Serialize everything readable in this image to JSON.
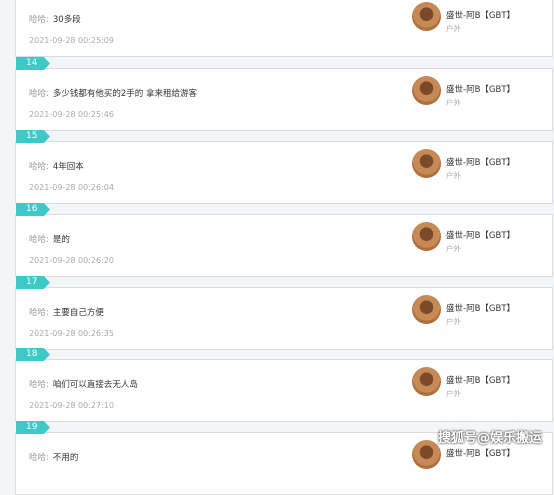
{
  "entries": [
    {
      "tab": "",
      "prefix": "哈哈:",
      "text": "30多段",
      "time": "2021-09-28 00:25:09",
      "user": "盛世-阿B【GBT】",
      "category": "户外"
    },
    {
      "tab": "14",
      "prefix": "哈哈:",
      "text": "多少钱都有他买的2手的 拿来租给游客",
      "time": "2021-09-28 00:25:46",
      "user": "盛世-阿B【GBT】",
      "category": "户外"
    },
    {
      "tab": "15",
      "prefix": "哈哈:",
      "text": "4年回本",
      "time": "2021-09-28 00:26:04",
      "user": "盛世-阿B【GBT】",
      "category": "户外"
    },
    {
      "tab": "16",
      "prefix": "哈哈:",
      "text": "是的",
      "time": "2021-09-28 00:26:20",
      "user": "盛世-阿B【GBT】",
      "category": "户外"
    },
    {
      "tab": "17",
      "prefix": "哈哈:",
      "text": "主要自己方便",
      "time": "2021-09-28 00:26:35",
      "user": "盛世-阿B【GBT】",
      "category": "户外"
    },
    {
      "tab": "18",
      "prefix": "哈哈:",
      "text": "咱们可以直接去无人岛",
      "time": "2021-09-28 00:27:10",
      "user": "盛世-阿B【GBT】",
      "category": "户外"
    },
    {
      "tab": "19",
      "prefix": "哈哈:",
      "text": "不用的",
      "time": "",
      "user": "盛世-阿B【GBT】",
      "category": ""
    }
  ],
  "watermark": "搜狐号@娱乐搬运",
  "colors": {
    "tab": "#3fc8c8",
    "card_border": "#d9dde1",
    "background": "#f4f5f7"
  },
  "icons": {
    "avatar": "user-avatar-photo"
  }
}
